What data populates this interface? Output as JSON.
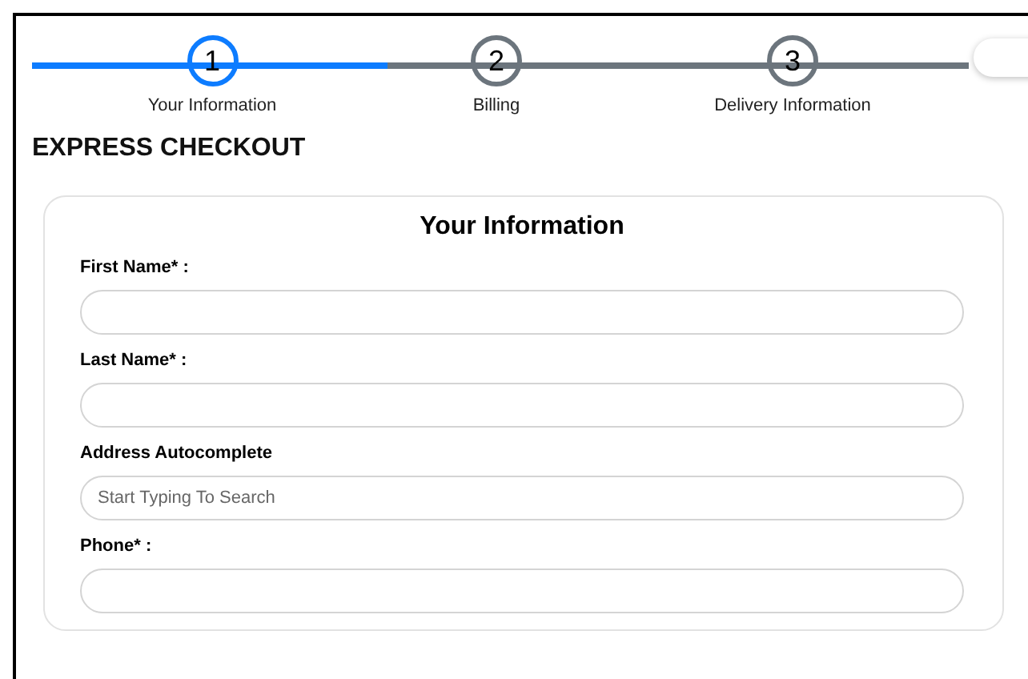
{
  "stepper": {
    "progress": {
      "level": 0.38
    },
    "steps": [
      {
        "number": "1",
        "label": "Your Information",
        "selected": true
      },
      {
        "number": "2",
        "label": "Billing",
        "selected": false
      },
      {
        "number": "3",
        "label": "Delivery Information",
        "selected": false
      }
    ]
  },
  "heading": "EXPRESS CHECKOUT",
  "form": {
    "title": "Your Information",
    "fields": [
      {
        "label": "First Name* :"
      },
      {
        "label": "Last Name* :"
      },
      {
        "label": "Address Autocomplete",
        "placeholder": "Start Typing To Search"
      },
      {
        "label": "Phone* :"
      }
    ]
  }
}
